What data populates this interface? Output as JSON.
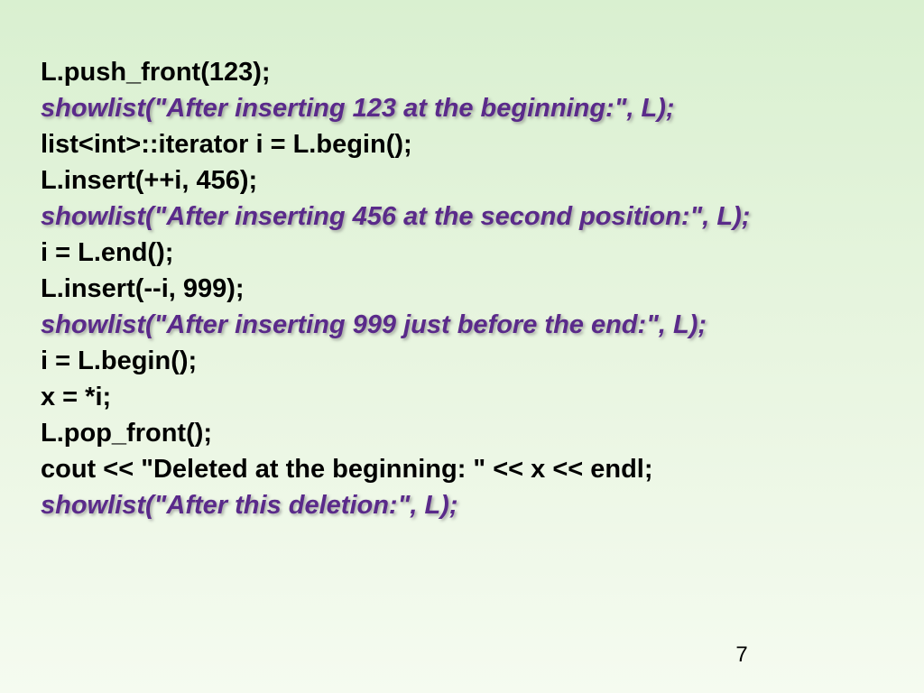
{
  "lines": [
    {
      "style": "normal",
      "text": "L.push_front(123);"
    },
    {
      "style": "emphasis",
      "text": "showlist(\"After inserting 123 at the beginning:\", L);"
    },
    {
      "style": "normal",
      "text": "list<int>::iterator i = L.begin();"
    },
    {
      "style": "normal",
      "text": "L.insert(++i, 456);"
    },
    {
      "style": "emphasis",
      "text": "showlist(\"After inserting 456 at the second position:\", L);"
    },
    {
      "style": "normal",
      "text": "i = L.end();"
    },
    {
      "style": "normal",
      "text": "L.insert(--i,  999);"
    },
    {
      "style": "emphasis",
      "text": "showlist(\"After inserting 999 just before the end:\",  L);"
    },
    {
      "style": "normal",
      "text": "i = L.begin();"
    },
    {
      "style": "normal",
      "text": "x = *i;"
    },
    {
      "style": "normal",
      "text": "L.pop_front();"
    },
    {
      "style": "normal",
      "text": "cout << \"Deleted at the beginning: \"  << x << endl;"
    },
    {
      "style": "emphasis",
      "text": "showlist(\"After this deletion:\",  L);"
    }
  ],
  "page_number": "7"
}
